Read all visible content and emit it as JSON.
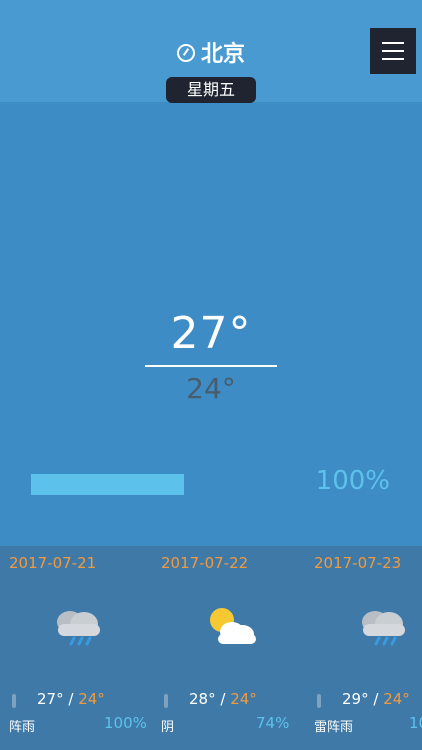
{
  "header": {
    "city": "北京",
    "weekday": "星期五"
  },
  "today": {
    "high": "27°",
    "low": "24°",
    "humidity_text": "100%",
    "humidity_fraction": 1.0
  },
  "forecast": [
    {
      "date": "2017-07-21",
      "high": "27°",
      "low": "24°",
      "condition": "阵雨",
      "humidity": "100%",
      "icon": "rain-cloud-icon"
    },
    {
      "date": "2017-07-22",
      "high": "28°",
      "low": "24°",
      "condition": "阴",
      "humidity": "74%",
      "icon": "sun-cloud-icon"
    },
    {
      "date": "2017-07-23",
      "high": "29°",
      "low": "24°",
      "condition": "雷阵雨",
      "humidity": "10",
      "icon": "rain-cloud-icon"
    }
  ],
  "colors": {
    "background": "#3d8cc6",
    "header": "#4a9ad2",
    "accent": "#5cc2ec",
    "date": "#f39a3c",
    "forecast_bg": "#3e79a8"
  }
}
